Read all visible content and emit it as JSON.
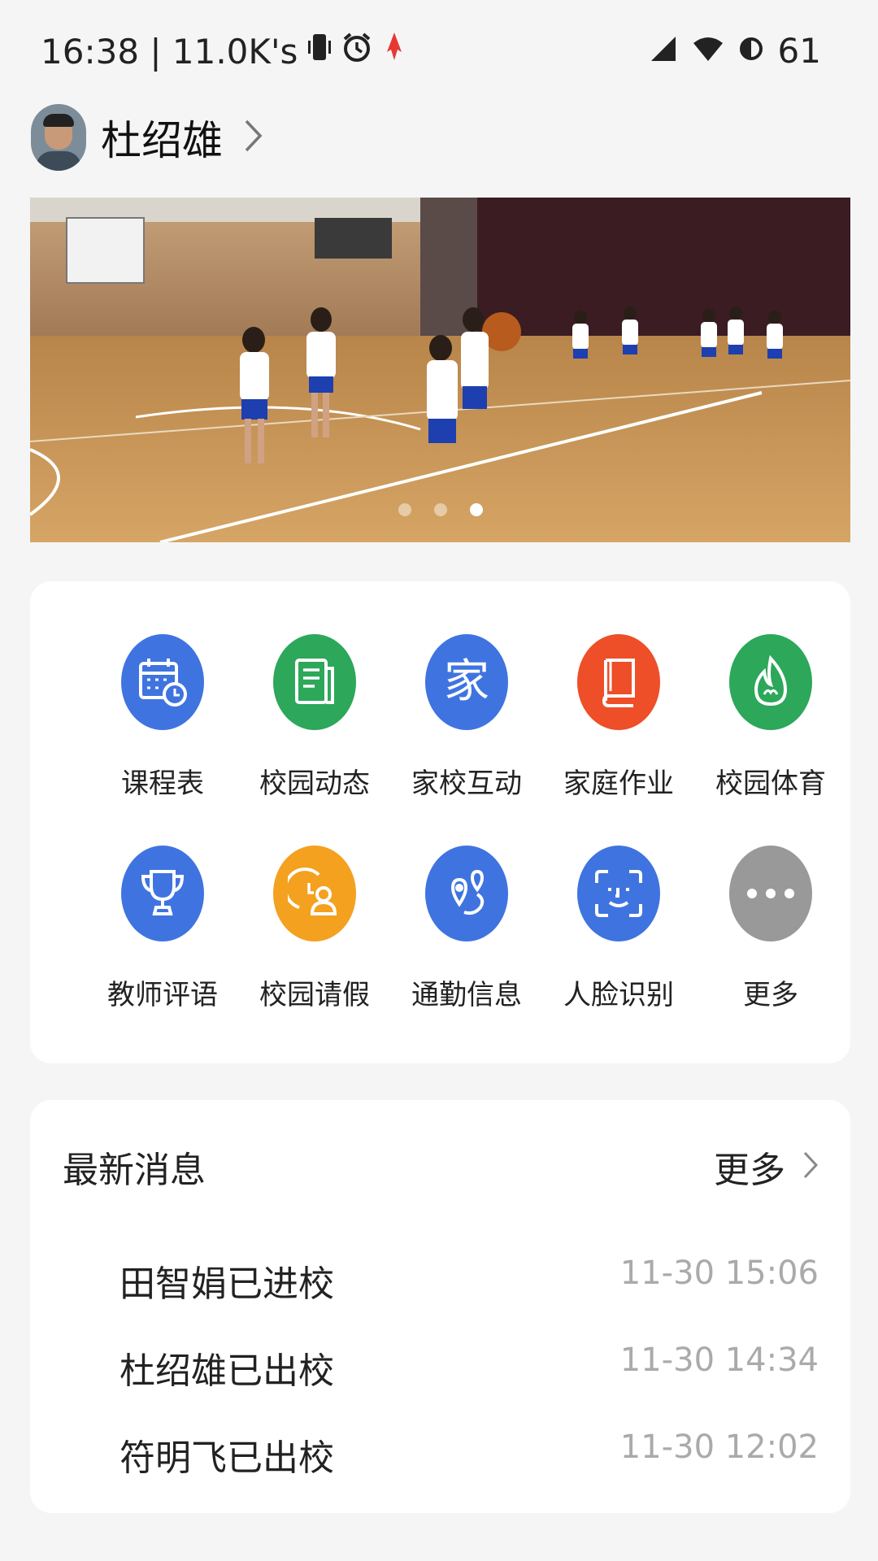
{
  "status_bar": {
    "time_speed": "16:38 | 11.0K's",
    "battery": "61"
  },
  "profile": {
    "name": "杜绍雄"
  },
  "banner": {
    "slide_count": 3,
    "active_index": 2
  },
  "functions": [
    {
      "label": "课程表",
      "icon": "calendar-clock-icon",
      "color": "#3f74e0"
    },
    {
      "label": "校园动态",
      "icon": "news-document-icon",
      "color": "#2da75a"
    },
    {
      "label": "家校互动",
      "icon": "home-character-icon",
      "glyph": "家",
      "color": "#3f74e0"
    },
    {
      "label": "家庭作业",
      "icon": "book-icon",
      "color": "#ee4e28"
    },
    {
      "label": "校园体育",
      "icon": "flame-icon",
      "color": "#2da75a"
    },
    {
      "label": "教师评语",
      "icon": "trophy-icon",
      "color": "#3f74e0"
    },
    {
      "label": "校园请假",
      "icon": "clock-person-icon",
      "color": "#f3a11f"
    },
    {
      "label": "通勤信息",
      "icon": "map-route-icon",
      "color": "#3f74e0"
    },
    {
      "label": "人脸识别",
      "icon": "face-scan-icon",
      "color": "#3f74e0"
    },
    {
      "label": "更多",
      "icon": "more-dots-icon",
      "color": "#999999"
    }
  ],
  "messages": {
    "title": "最新消息",
    "more_label": "更多",
    "items": [
      {
        "text": "田智娟已进校",
        "time": "11-30 15:06"
      },
      {
        "text": "杜绍雄已出校",
        "time": "11-30 14:34"
      },
      {
        "text": "符明飞已出校",
        "time": "11-30 12:02"
      }
    ]
  }
}
